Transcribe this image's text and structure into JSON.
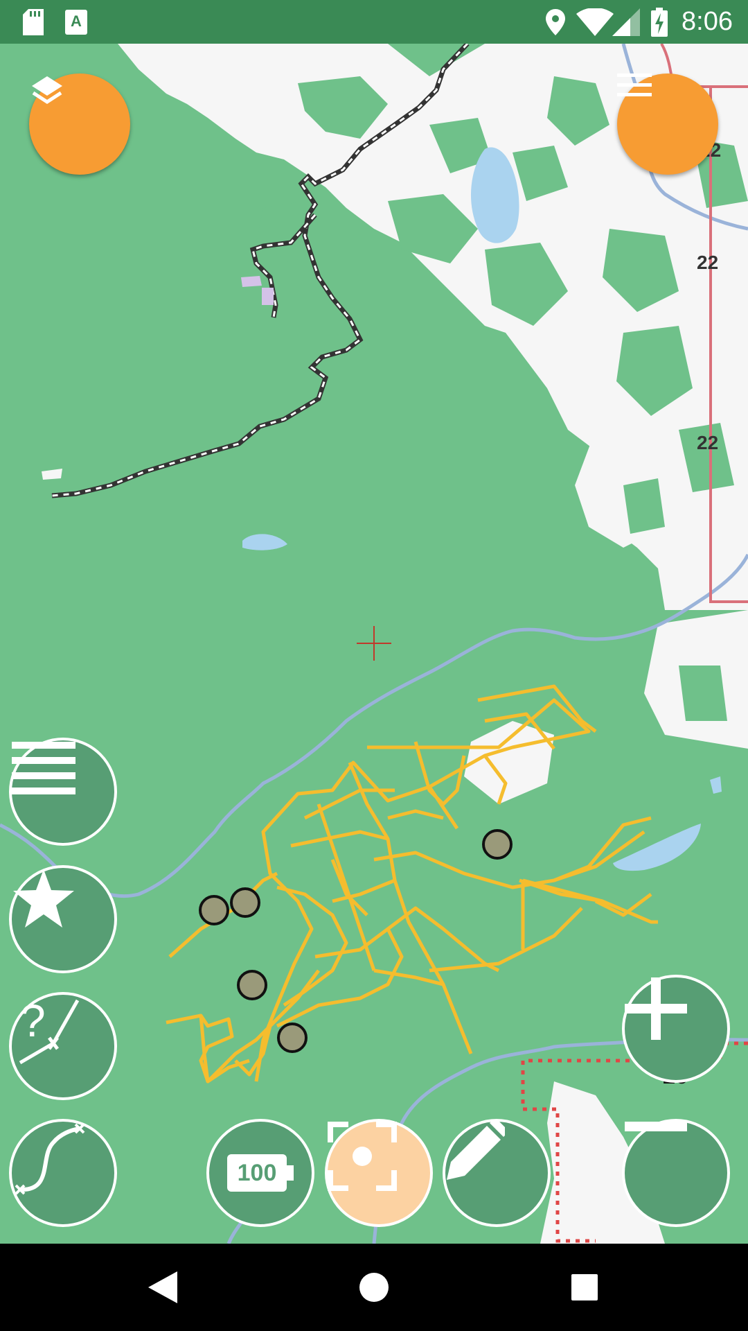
{
  "status_bar": {
    "time": "8:06",
    "icons": [
      "sd-card-icon",
      "text-badge-icon",
      "location-pin-icon",
      "wifi-icon",
      "cell-signal-icon",
      "battery-charging-icon"
    ]
  },
  "map": {
    "road_labels": [
      "22",
      "22",
      "22"
    ],
    "speed_label": "10",
    "crosshair": "crosshair-icon"
  },
  "buttons": {
    "layers": "layers-icon",
    "menu": "hamburger-menu-icon",
    "list": "list-icon",
    "favorites": "star-icon",
    "route_query": "route-query-icon",
    "track": "track-icon",
    "battery_level": "100",
    "center": "center-focus-icon",
    "edit": "pencil-icon",
    "zoom_in": "plus-icon",
    "zoom_out": "minus-icon"
  },
  "nav_bar": {
    "icons": [
      "back-icon",
      "home-icon",
      "recents-icon"
    ]
  },
  "colors": {
    "map_green": "#6fc18a",
    "fab_orange": "#f79c33",
    "fab_green": "#579e74",
    "route_yellow": "#f5bd2e",
    "status_bar": "#3a8a55"
  }
}
